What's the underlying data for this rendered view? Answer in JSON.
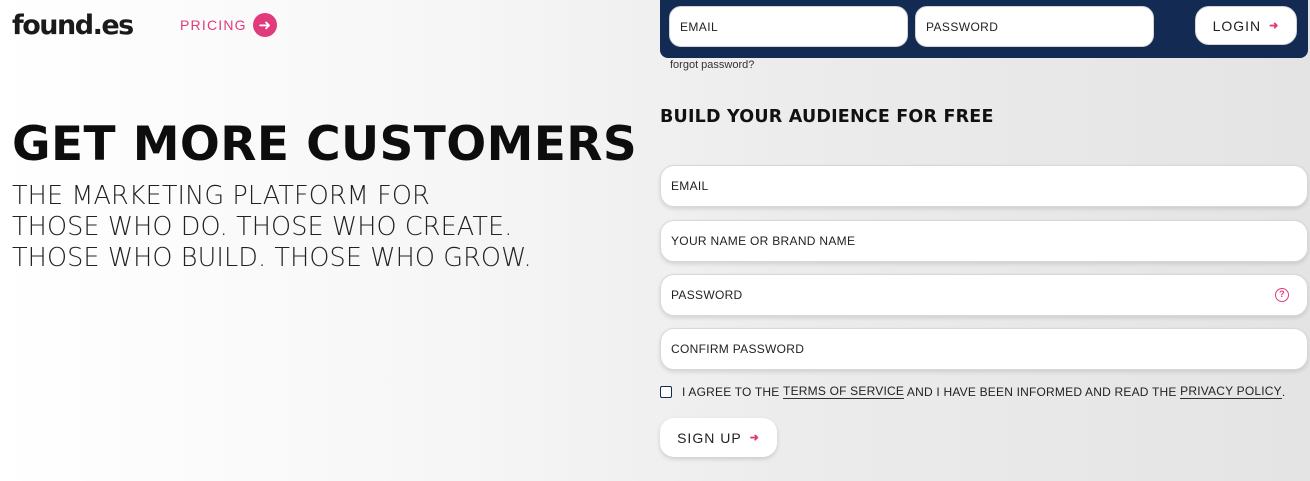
{
  "header": {
    "logo": "found.es",
    "pricing_label": "PRICING",
    "pricing_icon": "arrow-right-circle-icon"
  },
  "hero": {
    "headline": "GET MORE CUSTOMERS",
    "sub_lines": [
      "THE MARKETING PLATFORM FOR",
      "THOSE WHO DO. THOSE WHO CREATE.",
      "THOSE WHO BUILD. THOSE WHO GROW."
    ]
  },
  "login": {
    "email_placeholder": "EMAIL",
    "password_placeholder": "PASSWORD",
    "button_label": "LOGIN",
    "forgot_label": "forgot password?"
  },
  "signup": {
    "title": "BUILD YOUR AUDIENCE FOR FREE",
    "email_placeholder": "EMAIL",
    "name_placeholder": "YOUR NAME OR BRAND NAME",
    "password_placeholder": "PASSWORD",
    "confirm_placeholder": "CONFIRM PASSWORD",
    "help_glyph": "?",
    "agree_prefix": "I AGREE TO THE ",
    "terms_label": "TERMS OF SERVICE",
    "agree_middle": " AND I HAVE BEEN INFORMED AND READ THE ",
    "privacy_label": "PRIVACY POLICY",
    "agree_suffix": ".",
    "button_label": "SIGN UP"
  },
  "colors": {
    "accent": "#e23b7d",
    "navy": "#132a52"
  }
}
